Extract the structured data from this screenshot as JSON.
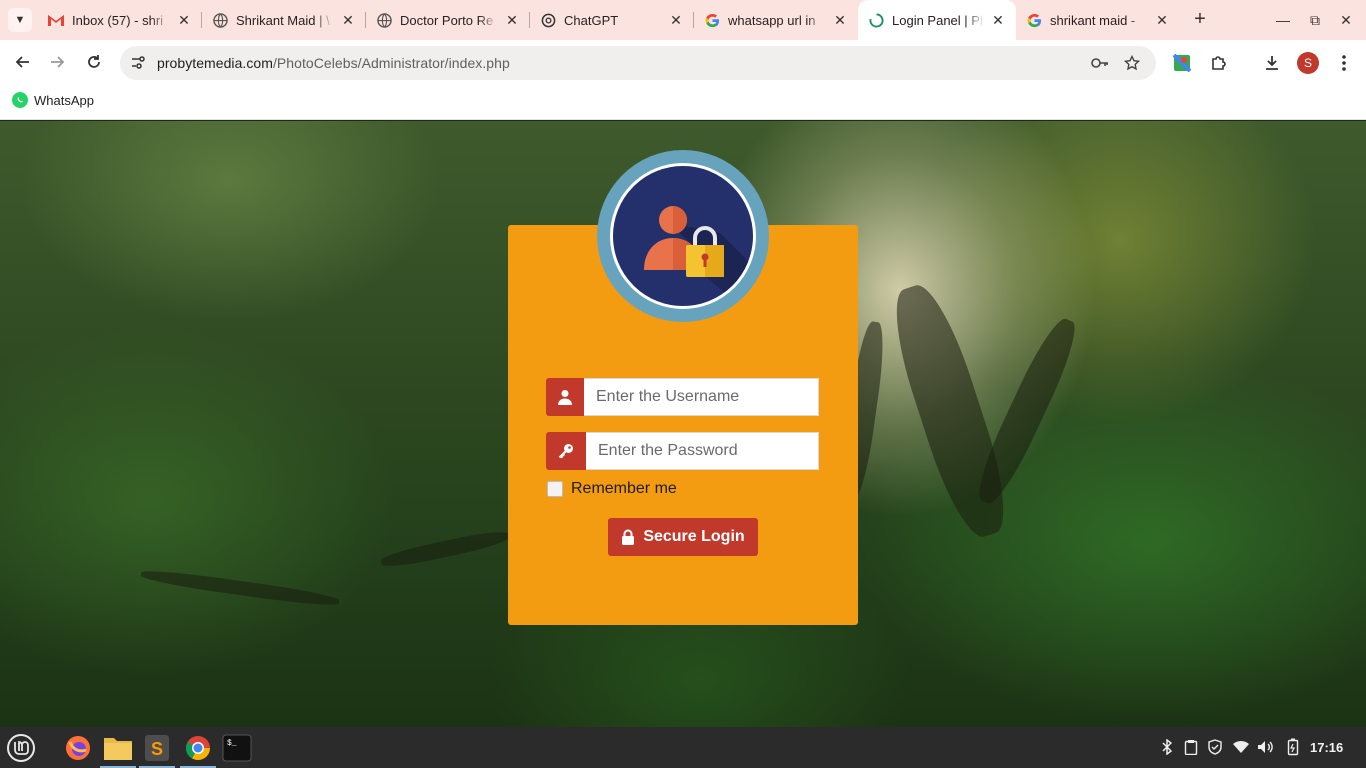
{
  "browser": {
    "tabs": [
      {
        "title": "Inbox (57) - shri",
        "icon": "gmail-icon",
        "active": false
      },
      {
        "title": "Shrikant Maid | \\",
        "icon": "globe-icon",
        "active": false
      },
      {
        "title": "Doctor Porto Re",
        "icon": "globe-icon",
        "active": false
      },
      {
        "title": "ChatGPT",
        "icon": "chatgpt-icon",
        "active": false
      },
      {
        "title": "whatsapp url in",
        "icon": "google-icon",
        "active": false
      },
      {
        "title": "Login Panel | Ph",
        "icon": "loading-icon",
        "active": true
      },
      {
        "title": "shrikant maid - ",
        "icon": "google-icon",
        "active": false
      }
    ],
    "url_host": "probytemedia.com",
    "url_path": "/PhotoCelebs/Administrator/index.php",
    "profile_initial": "S",
    "bookmarks": [
      {
        "label": "WhatsApp"
      }
    ]
  },
  "login": {
    "username_placeholder": "Enter the Username",
    "password_placeholder": "Enter the Password",
    "remember_label": "Remember me",
    "submit_label": "Secure Login",
    "card_color": "#f39c12",
    "accent_color": "#c0392b"
  },
  "taskbar": {
    "clock": "17:16",
    "apps": [
      "menu-icon",
      "firefox-icon",
      "files-icon",
      "sublime-icon",
      "chrome-icon",
      "terminal-icon"
    ]
  }
}
